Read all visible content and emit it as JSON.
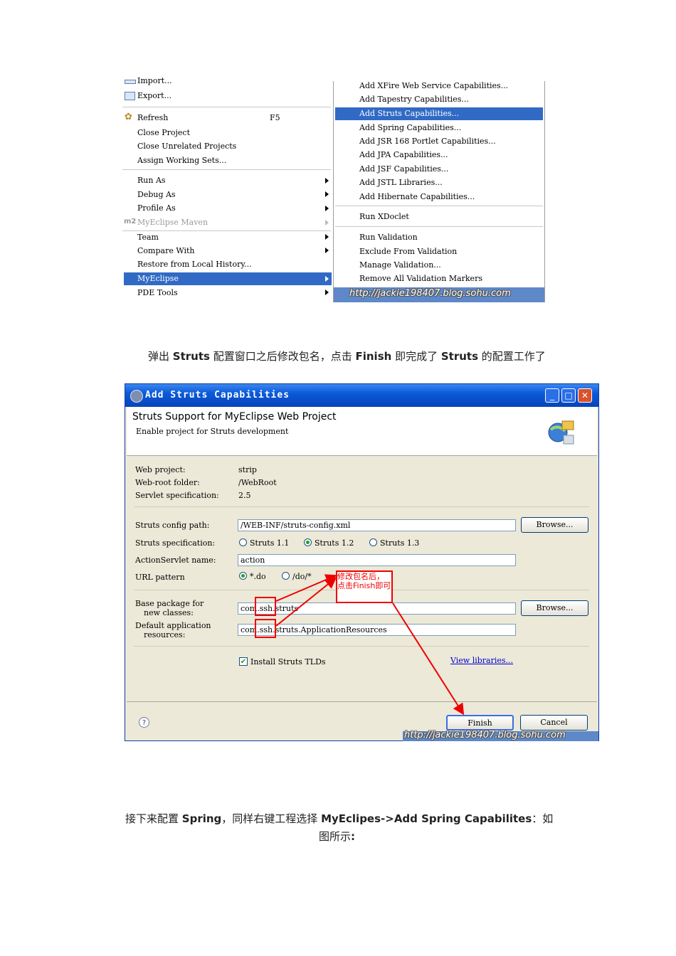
{
  "context_menu": {
    "left_items": [
      {
        "label": "Import...",
        "disabled": false
      },
      {
        "label": "Export...",
        "disabled": false
      },
      {
        "label": "Refresh",
        "shortcut": "F5",
        "disabled": false
      },
      {
        "label": "Close Project",
        "disabled": false
      },
      {
        "label": "Close Unrelated Projects",
        "disabled": false
      },
      {
        "label": "Assign Working Sets...",
        "disabled": false
      },
      {
        "label": "Run As",
        "disabled": false
      },
      {
        "label": "Debug As",
        "disabled": false
      },
      {
        "label": "Profile As",
        "disabled": false
      },
      {
        "label": "MyEclipse Maven",
        "prefix": "m2",
        "disabled": true
      },
      {
        "label": "Team",
        "disabled": false
      },
      {
        "label": "Compare With",
        "disabled": false
      },
      {
        "label": "Restore from Local History...",
        "disabled": false
      },
      {
        "label": "MyEclipse",
        "disabled": false,
        "selected": true
      },
      {
        "label": "PDE Tools",
        "disabled": false
      }
    ],
    "right_items": [
      {
        "label": "Add XFire Web Service Capabilities..."
      },
      {
        "label": "Add Tapestry Capabilities..."
      },
      {
        "label": "Add Struts Capabilities...",
        "selected": true
      },
      {
        "label": "Add Spring Capabilities..."
      },
      {
        "label": "Add JSR 168 Portlet Capabilities..."
      },
      {
        "label": "Add JPA Capabilities..."
      },
      {
        "label": "Add JSF Capabilities..."
      },
      {
        "label": "Add JSTL Libraries..."
      },
      {
        "label": "Add Hibernate Capabilities..."
      },
      {
        "label": "Run XDoclet"
      },
      {
        "label": "Run Validation"
      },
      {
        "label": "Exclude From Validation"
      },
      {
        "label": "Manage Validation..."
      },
      {
        "label": "Remove All Validation Markers"
      }
    ],
    "watermark": "http://jackie198407.blog.sohu.com"
  },
  "caption1": {
    "p1": "弹出 ",
    "b1": "Struts",
    "p2": " 配置窗口之后修改包名，点击 ",
    "b2": "Finish",
    "p3": " 即完成了 ",
    "b3": "Struts",
    "p4": " 的配置工作了"
  },
  "dialog": {
    "title": "Add Struts Capabilities",
    "heading": "Struts Support for MyEclipse Web Project",
    "subheading": "Enable project for Struts development",
    "web_project_label": "Web project:",
    "web_project_value": "strip",
    "web_root_label": "Web-root folder:",
    "web_root_value": "/WebRoot",
    "servlet_spec_label": "Servlet specification:",
    "servlet_spec_value": "2.5",
    "config_path_label": "Struts config path:",
    "config_path_value": "/WEB-INF/struts-config.xml",
    "browse_label": "Browse...",
    "struts_spec_label": "Struts specification:",
    "struts_spec_options": [
      "Struts 1.1",
      "Struts 1.2",
      "Struts 1.3"
    ],
    "struts_spec_selected": "Struts 1.2",
    "servlet_name_label": "ActionServlet name:",
    "servlet_name_value": "action",
    "url_pattern_label": "URL pattern",
    "url_pattern_options": [
      "*.do",
      "/do/*"
    ],
    "url_pattern_selected": "*.do",
    "base_package_label_1": "Base package for",
    "base_package_label_2": "new classes:",
    "base_package_value": "com.ssh.struts",
    "default_resources_label_1": "Default application",
    "default_resources_label_2": "resources:",
    "default_resources_value": "com.ssh.struts.ApplicationResources",
    "install_tlds_label": "Install Struts TLDs",
    "install_tlds_checked": true,
    "view_libraries_label": "View libraries...",
    "finish_label": "Finish",
    "cancel_label": "Cancel",
    "annotation": "修改包名后，点击Finish即可",
    "watermark": "http://jackie198407.blog.sohu.com"
  },
  "caption2": {
    "p1": "接下来配置 ",
    "b1": "Spring",
    "p2": "，同样右键工程选择 ",
    "b2": "MyEclipes->Add Spring Capabilites",
    "p3": "：如",
    "line2": "图所示",
    "line2_end": ":"
  },
  "colors": {
    "selection": "#316ac5",
    "titlebar": "#0a5ad9",
    "annotation": "#e00000"
  }
}
